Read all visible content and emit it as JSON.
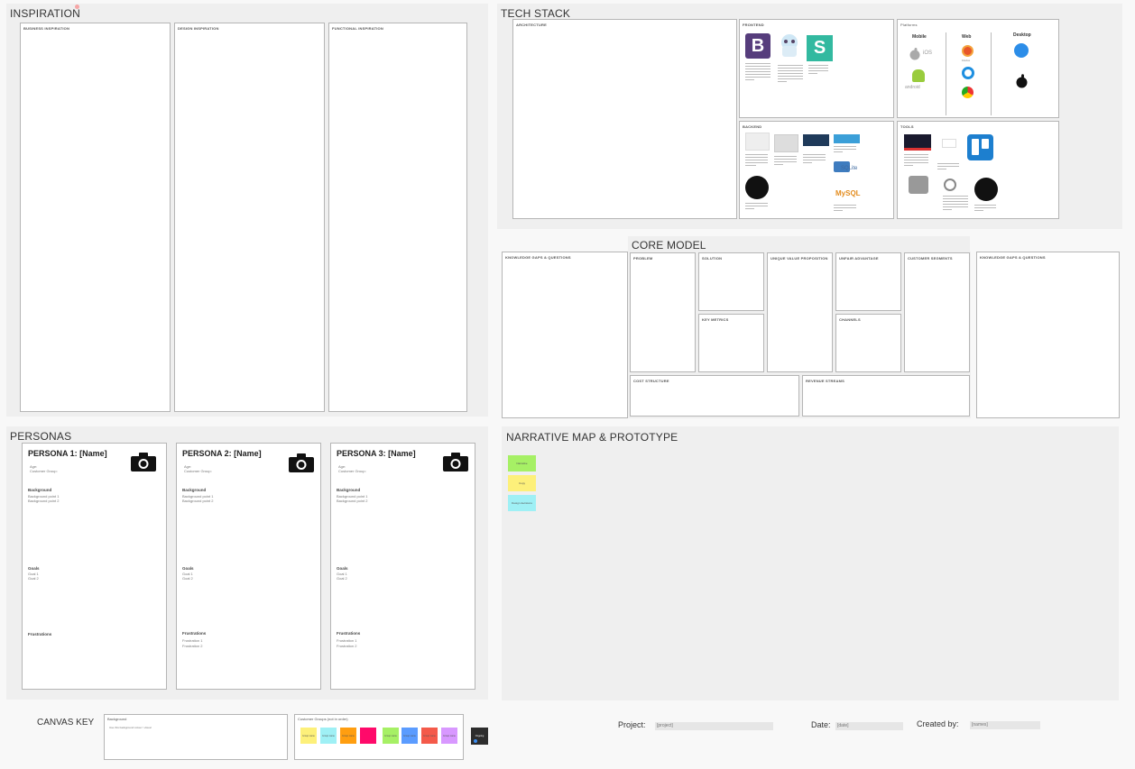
{
  "inspiration": {
    "title": "INSPIRATION",
    "columns": [
      "BUSINESS INSPIRATION",
      "DESIGN INSPIRATION",
      "FUNCTIONAL INSPIRATION"
    ]
  },
  "tech_stack": {
    "title": "TECH STACK",
    "architecture": "ARCHITECTURE",
    "frontend": "FRONTEND",
    "platforms": {
      "title": "Platforms",
      "mobile": "Mobile",
      "web": "Web",
      "desktop": "Desktop",
      "ios": "iOS",
      "android": "android",
      "firefox": "Firefox"
    },
    "backend": "BACKEND",
    "tools": "TOOLS",
    "sql_lite": "SQLite",
    "mysql": "MySQL",
    "stamplay": "StampPlay",
    "trello_letter": "",
    "bootstrap_letter": "B",
    "s_letter": "S"
  },
  "core_model": {
    "title": "CORE MODEL",
    "gaps_left": "KNOWLEDGE GAPS & QUESTIONS",
    "problem": "PROBLEM",
    "solution": "SOLUTION",
    "key_metrics": "KEY METRICS",
    "uvp": "UNIQUE VALUE PROPOSITION",
    "unfair_advantage": "UNFAIR ADVANTAGE",
    "channels": "CHANNELS",
    "customer_segments": "CUSTOMER SEGMENTS",
    "cost_structure": "COST STRUCTURE",
    "revenue_streams": "REVENUE STREAMS",
    "gaps_right": "KNOWLEDGE GAPS & QUESTIONS"
  },
  "personas": {
    "title": "PERSONAS",
    "cards": [
      {
        "name": "PERSONA 1: [Name]",
        "age": "Age:",
        "group": "Customer Group:",
        "background": "Background",
        "bg1": "Background point 1",
        "bg2": "Background point 2",
        "goals": "Goals",
        "g1": "Goal 1",
        "g2": "Goal 2",
        "frustrations": "Frustrations",
        "f1": "",
        "f2": ""
      },
      {
        "name": "PERSONA 2: [Name]",
        "age": "Age:",
        "group": "Customer Group:",
        "background": "Background",
        "bg1": "Background point 1",
        "bg2": "Background point 2",
        "goals": "Goals",
        "g1": "Goal 1",
        "g2": "Goal 2",
        "frustrations": "Frustrations",
        "f1": "Frustration 1",
        "f2": "Frustration 2"
      },
      {
        "name": "PERSONA 3: [Name]",
        "age": "Age:",
        "group": "Customer Group:",
        "background": "Background",
        "bg1": "Background point 1",
        "bg2": "Background point 2",
        "goals": "Goals",
        "g1": "Goal 1",
        "g2": "Goal 2",
        "frustrations": "Frustrations",
        "f1": "Frustration 1",
        "f2": "Frustration 2"
      }
    ]
  },
  "narrative": {
    "title": "NARRATIVE MAP & PROTOTYPE",
    "stickies": [
      {
        "label": "Narrative",
        "color": "#a6f065"
      },
      {
        "label": "Copy",
        "color": "#fdf07a"
      },
      {
        "label": "Design decisions",
        "color": "#9ff0f5"
      }
    ]
  },
  "canvas_key": {
    "label": "CANVAS KEY",
    "background_title": "Background",
    "background_text": "Use this background colour / visual",
    "groups_title": "Customer Groups (not in order)",
    "swatches": [
      {
        "color": "#fdf07a",
        "label": "Group name"
      },
      {
        "color": "#9ff0f5",
        "label": "Group name"
      },
      {
        "color": "#ff9e10",
        "label": "Group name"
      },
      {
        "color": "#ff0a6a",
        "label": ""
      },
      {
        "color": "#a6f065",
        "label": "Group name"
      },
      {
        "color": "#5b9cff",
        "label": "Group name"
      },
      {
        "color": "#f45a4a",
        "label": "Group name"
      },
      {
        "color": "#d898ff",
        "label": "Group name"
      }
    ],
    "dark_tile_text": "Ongoing"
  },
  "footer": {
    "project_label": "Project:",
    "project_value": "[project]",
    "date_label": "Date:",
    "date_value": "[date]",
    "created_label": "Created by:",
    "created_value": "[names]"
  }
}
